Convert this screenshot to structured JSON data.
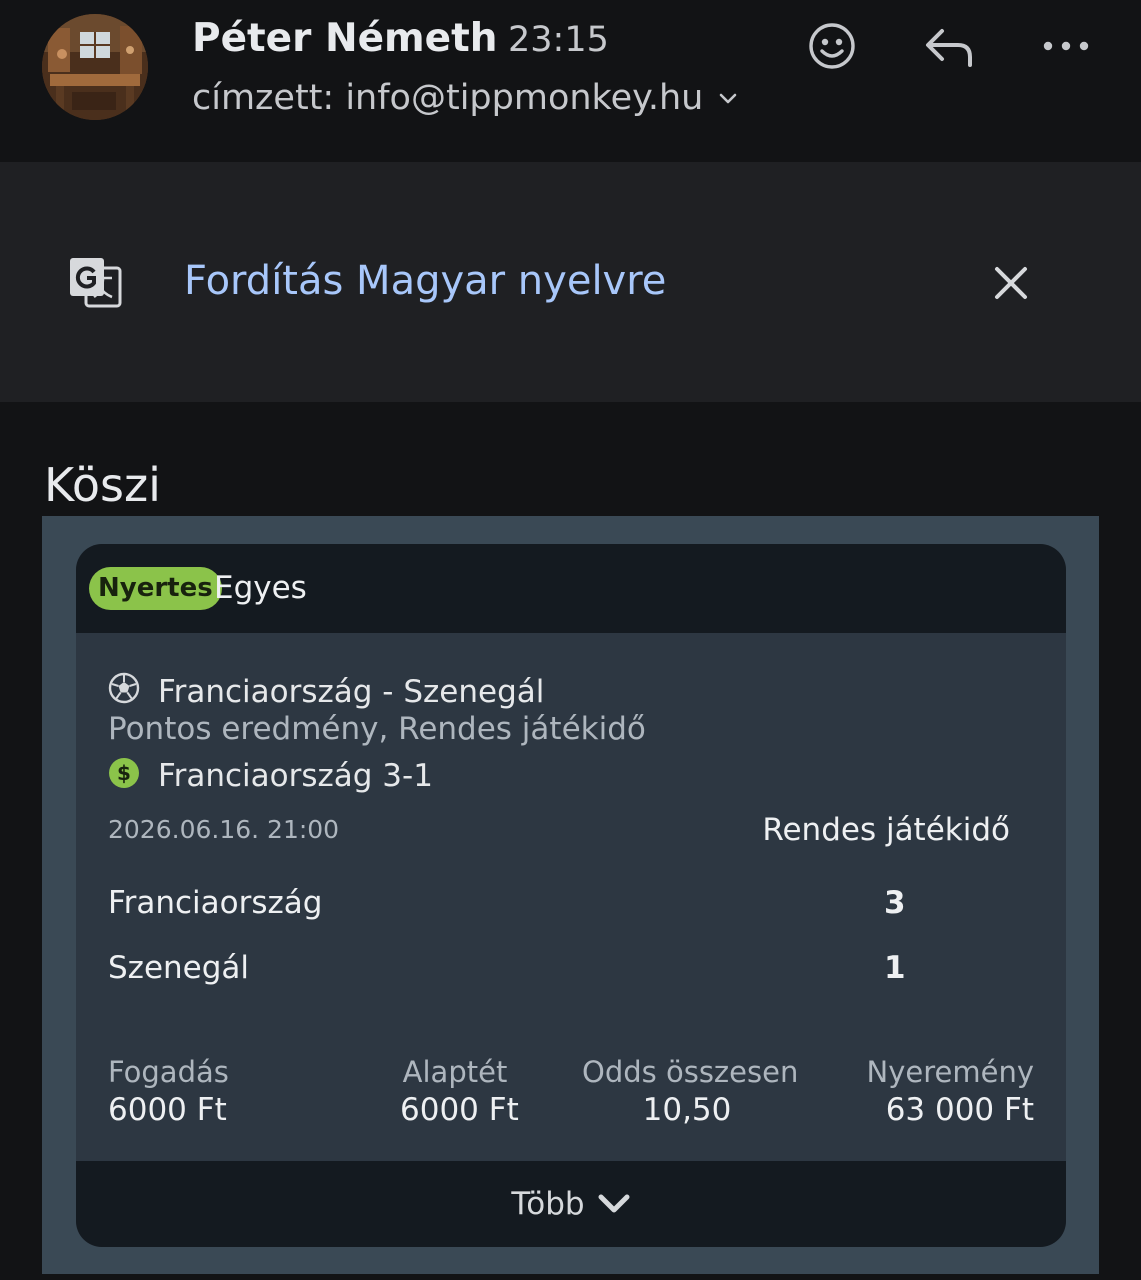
{
  "sender": {
    "name": "Péter Németh",
    "time": "23:15",
    "recipient": "címzett: info@tippmonkey.hu"
  },
  "header_actions": {
    "emoji_icon": "emoji-icon",
    "reply_icon": "reply-icon",
    "more_icon": "more-icon"
  },
  "translate": {
    "icon": "google-translate-icon",
    "link": "Fordítás Magyar nyelvre",
    "close_icon": "close-icon"
  },
  "message": {
    "greeting": "Köszi"
  },
  "bet": {
    "status_badge": "Nyertes",
    "type": "Egyes",
    "match": "Franciaország - Szenegál",
    "market": "Pontos eredmény, Rendes játékidő",
    "selection": "Franciaország 3-1",
    "datetime": "2026.06.16.  21:00",
    "period": "Rendes játékidő",
    "teams": [
      {
        "name": "Franciaország",
        "score": "3"
      },
      {
        "name": "Szenegál",
        "score": "1"
      }
    ],
    "stats": {
      "stake_label": "Fogadás",
      "stake_value": "6000 Ft",
      "base_label": "Alaptét",
      "base_value": "6000 Ft",
      "odds_label": "Odds összesen",
      "odds_value": "10,50",
      "win_label": "Nyeremény",
      "win_value": "63 000 Ft"
    },
    "more_label": "Több"
  },
  "colors": {
    "background": "#121315",
    "banner": "#1f2023",
    "link": "#a8c7fa",
    "card": "#2d3742",
    "card_header": "#141a20",
    "frame": "#3a4955",
    "win_badge": "#8bc34a"
  }
}
